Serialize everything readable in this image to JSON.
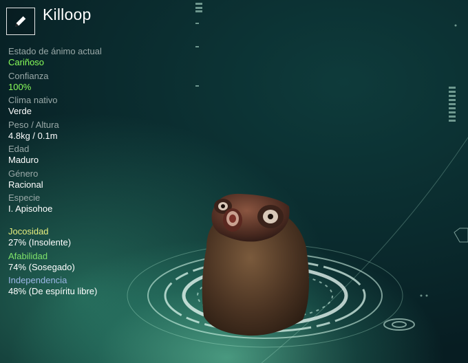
{
  "header": {
    "creature_name": "Killoop",
    "edit_icon": "pencil-icon"
  },
  "stats": [
    {
      "label": "Estado de ánimo actual",
      "value": "Cariñoso",
      "highlight": true
    },
    {
      "label": "Confianza",
      "value": "100%",
      "highlight": true
    },
    {
      "label": "Clima nativo",
      "value": "Verde",
      "highlight": false
    },
    {
      "label": "Peso / Altura",
      "value": "4.8kg / 0.1m",
      "highlight": false
    },
    {
      "label": "Edad",
      "value": "Maduro",
      "highlight": false
    },
    {
      "label": "Género",
      "value": "Racional",
      "highlight": false
    },
    {
      "label": "Especie",
      "value": "I. Apisohoe",
      "highlight": false
    }
  ],
  "traits": [
    {
      "label": "Jocosidad",
      "value": "27% (Insolente)",
      "color": "#e6ee7e"
    },
    {
      "label": "Afabilidad",
      "value": "74% (Sosegado)",
      "color": "#7fe36a"
    },
    {
      "label": "Independencia",
      "value": "48% (De espíritu libre)",
      "color": "#9cb7e6"
    }
  ],
  "colors": {
    "highlight_value": "#8aff5a",
    "label_grey": "#9aa9a8",
    "background_teal": "#0e3b3b"
  }
}
